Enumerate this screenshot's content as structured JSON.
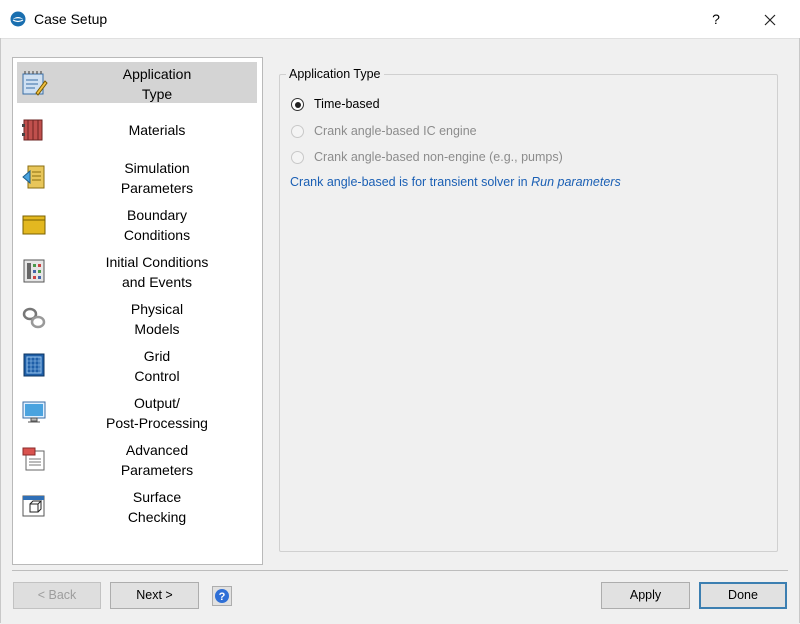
{
  "window": {
    "title": "Case Setup",
    "help_glyph": "?",
    "close_glyph": "✕"
  },
  "nav": {
    "items": [
      {
        "label": "Application\nType",
        "icon": "application-type-icon"
      },
      {
        "label": "Materials",
        "icon": "materials-icon"
      },
      {
        "label": "Simulation\nParameters",
        "icon": "simulation-parameters-icon"
      },
      {
        "label": "Boundary\nConditions",
        "icon": "boundary-conditions-icon"
      },
      {
        "label": "Initial Conditions\nand Events",
        "icon": "initial-conditions-icon"
      },
      {
        "label": "Physical\nModels",
        "icon": "physical-models-icon"
      },
      {
        "label": "Grid\nControl",
        "icon": "grid-control-icon"
      },
      {
        "label": "Output/\nPost-Processing",
        "icon": "output-icon"
      },
      {
        "label": "Advanced\nParameters",
        "icon": "advanced-parameters-icon"
      },
      {
        "label": "Surface\nChecking",
        "icon": "surface-checking-icon"
      }
    ]
  },
  "panel": {
    "title": "Application Type",
    "options": [
      {
        "label": "Time-based",
        "checked": true,
        "enabled": true
      },
      {
        "label": "Crank angle-based IC engine",
        "checked": false,
        "enabled": false
      },
      {
        "label": "Crank angle-based non-engine (e.g., pumps)",
        "checked": false,
        "enabled": false
      }
    ],
    "info_prefix": "Crank angle-based is for transient solver in ",
    "info_link": "Run parameters"
  },
  "buttons": {
    "back": "< Back",
    "next": "Next >",
    "apply": "Apply",
    "done": "Done"
  },
  "colors": {
    "accent": "#1a5fb4",
    "selected_nav": "#d4d4d4",
    "default_border": "#3c7fb1"
  }
}
